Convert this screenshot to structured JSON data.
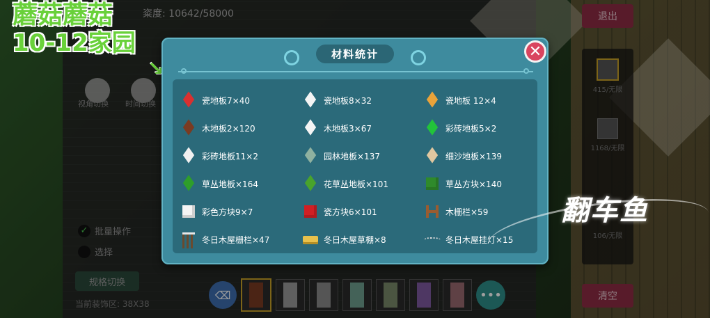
{
  "hud": {
    "progress": "粢度: 10642/58000",
    "exit_label": "退出",
    "clear_label": "清空",
    "tool_switch_label": "视角切换",
    "time_switch_label": "时间切换",
    "batch_label": "批量操作",
    "select_label": "选择",
    "spec_switch_label": "规格切换",
    "size_label": "当前装饰区: 38X38",
    "side_counts": [
      "415/无限",
      "1168/无限",
      "106/无限"
    ]
  },
  "caption": {
    "line1": "蘑菇蘑菇",
    "line2": "10-12家园",
    "arrow": "↘"
  },
  "watermark": "翻车鱼",
  "dialog": {
    "title": "材料统计",
    "close_glyph": "✕",
    "materials": [
      {
        "label": "瓷地板7×40",
        "icon": "tile",
        "color": "#d93030"
      },
      {
        "label": "瓷地板8×32",
        "icon": "tile",
        "color": "#f4f4f4"
      },
      {
        "label": "瓷地板 12×4",
        "icon": "tile",
        "color": "#e9a33a"
      },
      {
        "label": "木地板2×120",
        "icon": "tile",
        "color": "#7a3b22"
      },
      {
        "label": "木地板3×67",
        "icon": "tile",
        "color": "#f4f4f4"
      },
      {
        "label": "彩砖地板5×2",
        "icon": "tile",
        "color": "#22c33a"
      },
      {
        "label": "彩砖地板11×2",
        "icon": "tile",
        "color": "#f0f0f0"
      },
      {
        "label": "园林地板×137",
        "icon": "tile",
        "color": "#8fb1a0"
      },
      {
        "label": "细沙地板×139",
        "icon": "tile",
        "color": "#e0c7a0"
      },
      {
        "label": "草丛地板×164",
        "icon": "tile",
        "color": "#2e9e2a"
      },
      {
        "label": "花草丛地板×101",
        "icon": "tile",
        "color": "#49a32c"
      },
      {
        "label": "草丛方块×140",
        "icon": "cube",
        "color": "#2f8a2b"
      },
      {
        "label": "彩色方块9×7",
        "icon": "cube",
        "color": "#f4f4f4"
      },
      {
        "label": "瓷方块6×101",
        "icon": "cube",
        "color": "#d01f24"
      },
      {
        "label": "木栅栏×59",
        "icon": "fence",
        "color": "#9a5c30"
      },
      {
        "label": "冬日木屋栅栏×47",
        "icon": "wfence",
        "color": "#6a4a2e"
      },
      {
        "label": "冬日木屋草棚×8",
        "icon": "hay",
        "color": "#e8c14c"
      },
      {
        "label": "冬日木屋挂灯×15",
        "icon": "lamp",
        "color": "#d8d8d8"
      }
    ]
  }
}
